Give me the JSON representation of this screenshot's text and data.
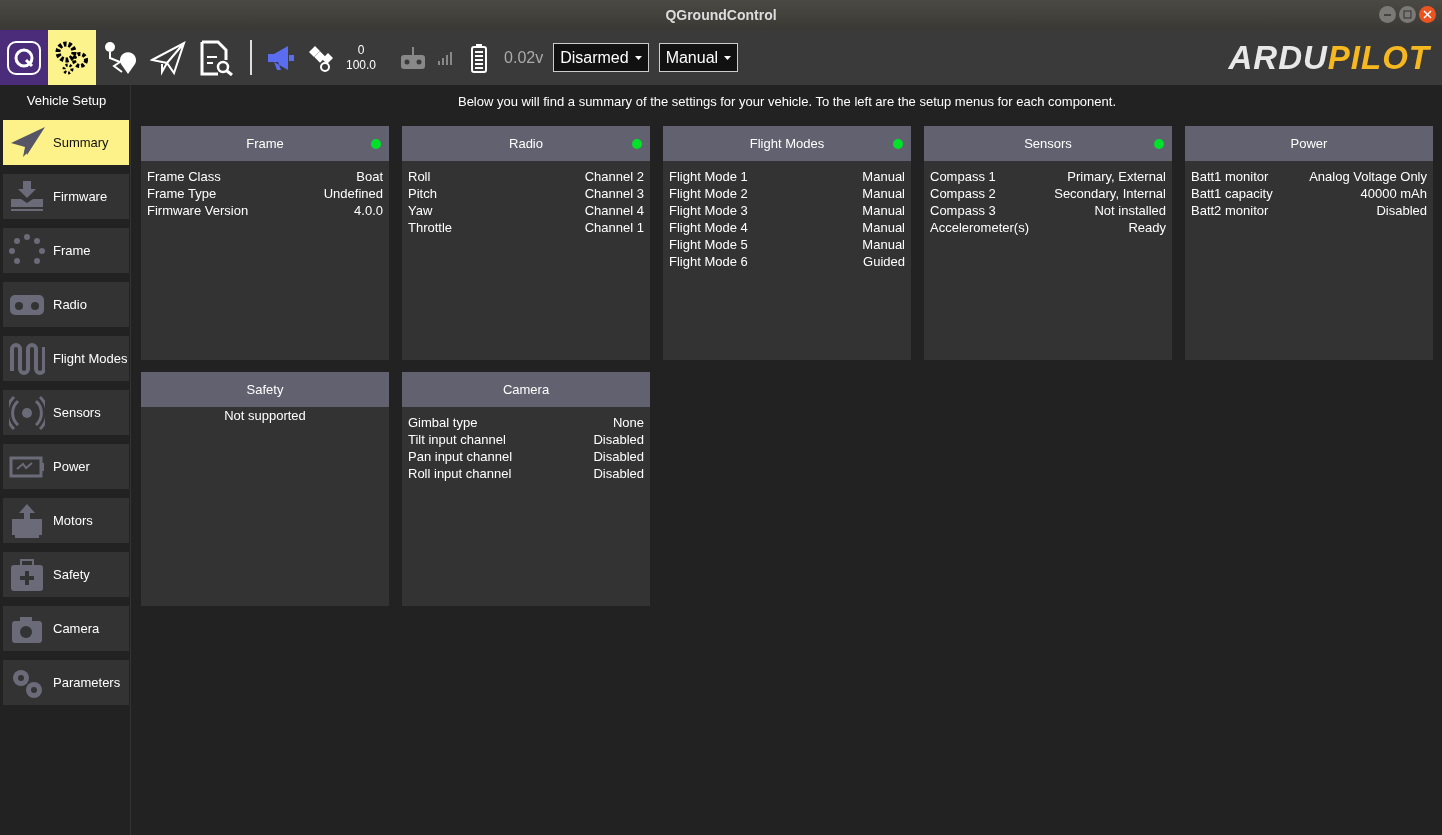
{
  "window": {
    "title": "QGroundControl"
  },
  "toolbar": {
    "tools": [
      {
        "selected": false
      },
      {
        "selected": true
      },
      {
        "selected": false
      },
      {
        "selected": false
      },
      {
        "selected": false
      }
    ],
    "satellite_count": "0",
    "hdop": "100.0",
    "battery": "0.02v",
    "arm_dropdown": "Disarmed",
    "mode_dropdown": "Manual",
    "brand_logo": [
      "ARDU",
      "PILOT"
    ]
  },
  "sidebar": {
    "title": "Vehicle Setup",
    "items": [
      {
        "label": "Summary",
        "selected": true
      },
      {
        "label": "Firmware",
        "selected": false
      },
      {
        "label": "Frame",
        "selected": false
      },
      {
        "label": "Radio",
        "selected": false
      },
      {
        "label": "Flight Modes",
        "selected": false
      },
      {
        "label": "Sensors",
        "selected": false
      },
      {
        "label": "Power",
        "selected": false
      },
      {
        "label": "Motors",
        "selected": false
      },
      {
        "label": "Safety",
        "selected": false
      },
      {
        "label": "Camera",
        "selected": false
      },
      {
        "label": "Parameters",
        "selected": false
      }
    ]
  },
  "summary_text": "Below you will find a summary of the settings for your vehicle. To the left are the setup menus for each component.",
  "cards": [
    {
      "title": "Frame",
      "color": "#00e12a",
      "rows": [
        [
          "Frame Class",
          "Boat"
        ],
        [
          "Frame Type",
          "Undefined"
        ],
        [
          "Firmware Version",
          "4.0.0"
        ]
      ]
    },
    {
      "title": "Radio",
      "color": "#00e12a",
      "rows": [
        [
          "Roll",
          "Channel 2"
        ],
        [
          "Pitch",
          "Channel 3"
        ],
        [
          "Yaw",
          "Channel 4"
        ],
        [
          "Throttle",
          "Channel 1"
        ]
      ]
    },
    {
      "title": "Flight Modes",
      "color": "#00e12a",
      "rows": [
        [
          "Flight Mode 1",
          "Manual"
        ],
        [
          "Flight Mode 2",
          "Manual"
        ],
        [
          "Flight Mode 3",
          "Manual"
        ],
        [
          "Flight Mode 4",
          "Manual"
        ],
        [
          "Flight Mode 5",
          "Manual"
        ],
        [
          "Flight Mode 6",
          "Guided"
        ]
      ]
    },
    {
      "title": "Sensors",
      "color": "#00e12a",
      "rows": [
        [
          "Compass 1",
          "Primary, External"
        ],
        [
          "Compass 2",
          "Secondary, Internal"
        ],
        [
          "Compass 3",
          "Not installed"
        ],
        [
          "Accelerometer(s)",
          "Ready"
        ]
      ]
    },
    {
      "title": "Power",
      "rows": [
        [
          "Batt1 monitor",
          "Analog Voltage Only"
        ],
        [
          "Batt1 capacity",
          "40000 mAh"
        ],
        [
          "Batt2 monitor",
          "Disabled"
        ]
      ]
    },
    {
      "title": "Safety",
      "message": "Not supported"
    },
    {
      "title": "Camera",
      "rows": [
        [
          "Gimbal type",
          "None"
        ],
        [
          "Tilt input channel",
          "Disabled"
        ],
        [
          "Pan input channel",
          "Disabled"
        ],
        [
          "Roll input channel",
          "Disabled"
        ]
      ]
    }
  ]
}
